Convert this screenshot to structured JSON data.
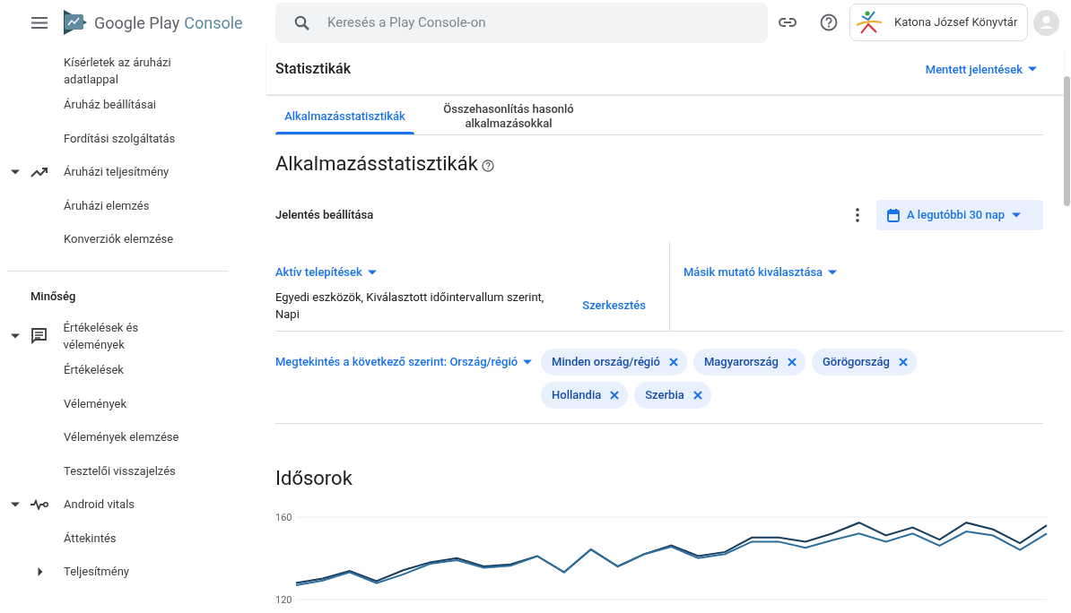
{
  "header": {
    "brand": "Google Play",
    "brand_product": "Console",
    "search": {
      "placeholder": "Keresés a Play Console-on"
    },
    "account": "Katona József Könyvtár"
  },
  "sidebar": {
    "items": [
      {
        "kind": "link",
        "label": "Kísérletek az áruházi adatlappal"
      },
      {
        "kind": "link",
        "label": "Áruház beállításai"
      },
      {
        "kind": "link",
        "label": "Fordítási szolgáltatás"
      },
      {
        "kind": "group",
        "label": "Áruházi teljesítmény",
        "expanded": true,
        "children": [
          {
            "label": "Áruházi elemzés"
          },
          {
            "label": "Konverziók elemzése"
          }
        ]
      },
      {
        "kind": "divider"
      },
      {
        "kind": "heading",
        "label": "Minőség"
      },
      {
        "kind": "group",
        "label": "Értékelések és vélemények",
        "expanded": true,
        "children": [
          {
            "label": "Értékelések"
          },
          {
            "label": "Vélemények"
          },
          {
            "label": "Vélemények elemzése"
          },
          {
            "label": "Tesztelői visszajelzés"
          }
        ]
      },
      {
        "kind": "group",
        "label": "Android vitals",
        "expanded": true,
        "children": [
          {
            "label": "Áttekintés"
          },
          {
            "label": "Teljesítmény",
            "expanded": false
          }
        ]
      }
    ]
  },
  "page": {
    "title": "Statisztikák",
    "saved_reports": "Mentett jelentések",
    "tabs": [
      {
        "label": "Alkalmazásstatisztikák",
        "selected": true
      },
      {
        "label": "Összehasonlítás hasonló alkalmazásokkal",
        "selected": false
      }
    ],
    "heading": "Alkalmazásstatisztikák",
    "report_settings": "Jelentés beállítása",
    "date_range": "A legutóbbi 30 nap",
    "metric": {
      "label": "Aktív telepítések",
      "description": "Egyedi eszközök, Kiválasztott időintervallum szerint, Napi",
      "edit": "Szerkesztés"
    },
    "second_metric": "Másik mutató kiválasztása",
    "breakdown": "Megtekintés a következő szerint: Ország/régió",
    "chips": [
      "Minden ország/régió",
      "Magyarország",
      "Görögország",
      "Hollandia",
      "Szerbia"
    ],
    "section_title": "Idősorok",
    "chart_data": {
      "type": "line",
      "ylim": [
        120,
        160
      ],
      "yticks": [
        120,
        160
      ],
      "series": [
        {
          "color": "#173d5c",
          "values": [
            128.0,
            130.2,
            133.9,
            128.9,
            134.2,
            138.1,
            140.1,
            136.1,
            137.1,
            141.1,
            133.2,
            144.3,
            136.1,
            142.1,
            146.3,
            141.1,
            143.1,
            150.1,
            150.1,
            148.1,
            152.1,
            157.3,
            151.1,
            155.0,
            149.1,
            157.3,
            154.0,
            147.3,
            156.0
          ]
        },
        {
          "color": "#2a6d9e",
          "values": [
            127.0,
            129.2,
            133.2,
            128.0,
            132.2,
            137.4,
            139.1,
            135.4,
            136.4,
            141.1,
            133.2,
            144.3,
            136.1,
            142.1,
            145.6,
            140.1,
            142.1,
            148.1,
            148.1,
            145.1,
            148.8,
            152.0,
            148.1,
            152.0,
            146.1,
            153.0,
            151.1,
            144.1,
            152.0
          ]
        }
      ]
    }
  }
}
